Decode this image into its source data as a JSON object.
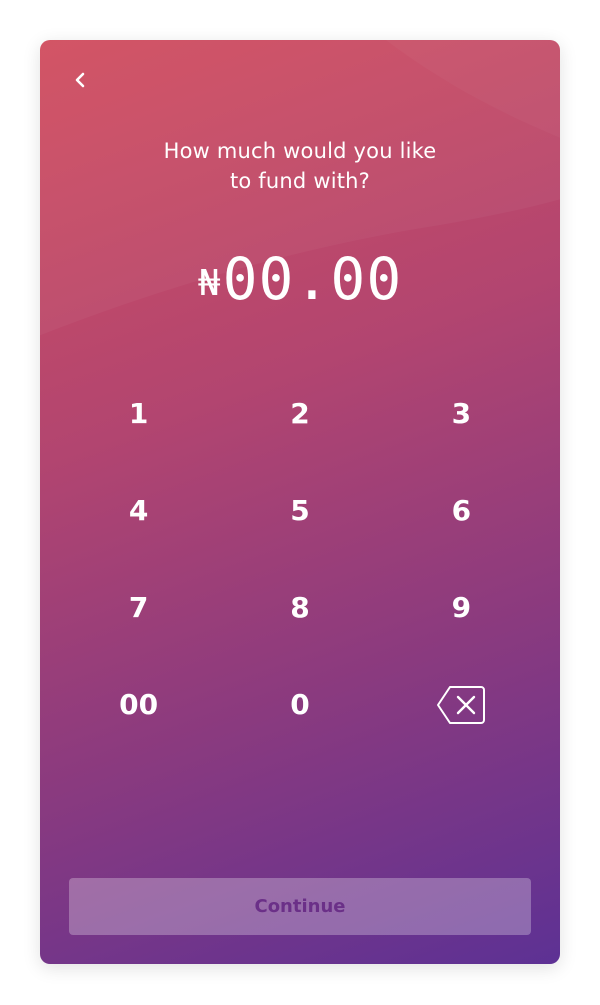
{
  "header": {
    "back_icon": "chevron-left-icon"
  },
  "prompt": {
    "line1": "How much would you like",
    "line2": "to fund with?"
  },
  "amount": {
    "currency_symbol": "₦",
    "value": "00.00"
  },
  "keypad": {
    "keys": [
      "1",
      "2",
      "3",
      "4",
      "5",
      "6",
      "7",
      "8",
      "9",
      "00",
      "0"
    ],
    "backspace_icon": "backspace-icon"
  },
  "actions": {
    "continue_label": "Continue"
  },
  "colors": {
    "gradient_start": "#d24f5f",
    "gradient_mid": "#8a3a7f",
    "gradient_end": "#5d3194",
    "continue_text": "#6b3088"
  }
}
